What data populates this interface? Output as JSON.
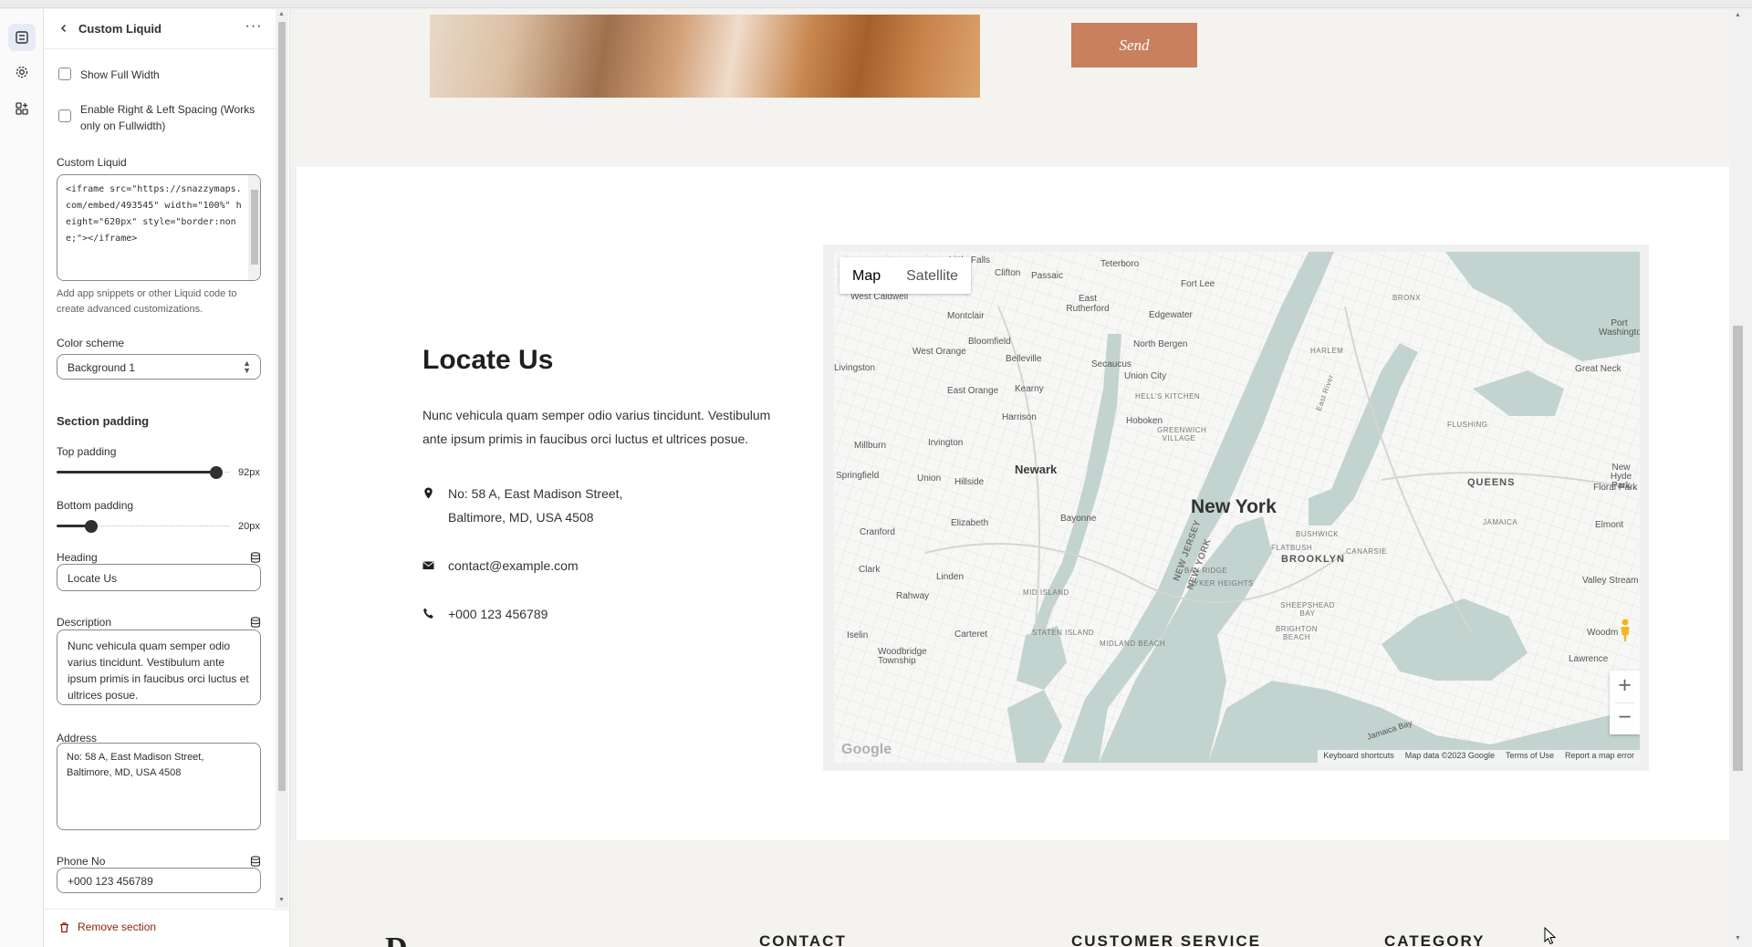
{
  "rail": {
    "items": [
      {
        "icon": "sections-icon",
        "active": true
      },
      {
        "icon": "gear-icon",
        "active": false
      },
      {
        "icon": "apps-icon",
        "active": false
      }
    ]
  },
  "panel": {
    "title": "Custom Liquid",
    "show_full_width_label": "Show Full Width",
    "enable_spacing_label": "Enable Right & Left Spacing (Works only on Fullwidth)",
    "custom_liquid_label": "Custom Liquid",
    "custom_liquid_value": "<iframe src=\"https://snazzymaps.com/embed/493545\" width=\"100%\" height=\"620px\" style=\"border:none;\"></iframe>",
    "custom_liquid_help": "Add app snippets or other Liquid code to create advanced customizations.",
    "color_scheme_label": "Color scheme",
    "color_scheme_value": "Background 1",
    "section_padding_heading": "Section padding",
    "top_padding_label": "Top padding",
    "top_padding_value": "92px",
    "top_padding_fraction": 0.92,
    "bottom_padding_label": "Bottom padding",
    "bottom_padding_value": "20px",
    "bottom_padding_fraction": 0.2,
    "heading_label": "Heading",
    "heading_value": "Locate Us",
    "description_label": "Description",
    "description_value": "Nunc vehicula quam semper odio varius tincidunt. Vestibulum ante ipsum primis in faucibus orci luctus et ultrices posue.",
    "address_label": "Address",
    "address_value": "No: 58 A, East Madison Street, Baltimore, MD, USA 4508",
    "phone_label": "Phone No",
    "phone_value": "+000 123 456789",
    "remove_label": "Remove section"
  },
  "preview": {
    "send_label": "Send",
    "locate_heading": "Locate Us",
    "locate_desc": "Nunc vehicula quam semper odio varius tincidunt. Vestibulum ante ipsum primis in faucibus orci luctus et ultrices posue.",
    "address_line1": "No: 58 A, East Madison Street,",
    "address_line2": "Baltimore, MD, USA 4508",
    "email": "contact@example.com",
    "phone": "+000 123 456789",
    "footer_logo": "D",
    "footer_cols": [
      "CONTACT",
      "CUSTOMER SERVICE",
      "CATEGORY"
    ]
  },
  "map": {
    "type_map": "Map",
    "type_satellite": "Satellite",
    "zoom_in": "+",
    "zoom_out": "−",
    "google": "Google",
    "attribution": [
      "Keyboard shortcuts",
      "Map data ©2023 Google",
      "Terms of Use",
      "Report a map error"
    ],
    "center_label": "New York",
    "city_labels": [
      "Newark"
    ],
    "borough_labels": [
      "BROOKLYN",
      "QUEENS",
      "BRONX",
      "HARLEM"
    ],
    "place_labels": [
      "Little Falls",
      "Clifton",
      "Passaic",
      "Teterboro",
      "Fort Lee",
      "West Caldwell",
      "East Rutherford",
      "Edgewater",
      "Montclair",
      "Bloomfield",
      "North Bergen",
      "West Orange",
      "Belleville",
      "Secaucus",
      "Union City",
      "Livingston",
      "East Orange",
      "Kearny",
      "HELL'S KITCHEN",
      "Harrison",
      "Hoboken",
      "GREENWICH VILLAGE",
      "Millburn",
      "Irvington",
      "Springfield",
      "Union",
      "Hillside",
      "Elizabeth",
      "Bayonne",
      "Cranford",
      "Clark",
      "Linden",
      "Rahway",
      "Carteret",
      "Woodbridge Township",
      "Iselin",
      "MID ISLAND",
      "STATEN ISLAND",
      "MIDLAND BEACH",
      "BAY RIDGE",
      "DYKER HEIGHTS",
      "SHEEPSHEAD BAY",
      "BRIGHTON BEACH",
      "FLATBUSH",
      "CANARSIE",
      "BUSHWICK",
      "JAMAICA",
      "FLUSHING",
      "Port Washington",
      "Great Neck",
      "New Hyde Park",
      "Floral Park",
      "Elmont",
      "Valley Stream",
      "Woodm",
      "Lawrence",
      "Jamaica Bay",
      "East River",
      "NEW JERSEY",
      "NEW YORK"
    ]
  },
  "colors": {
    "accent_button": "#c8805e",
    "remove": "#8e1f0b",
    "map_water": "#c3d3cf"
  }
}
